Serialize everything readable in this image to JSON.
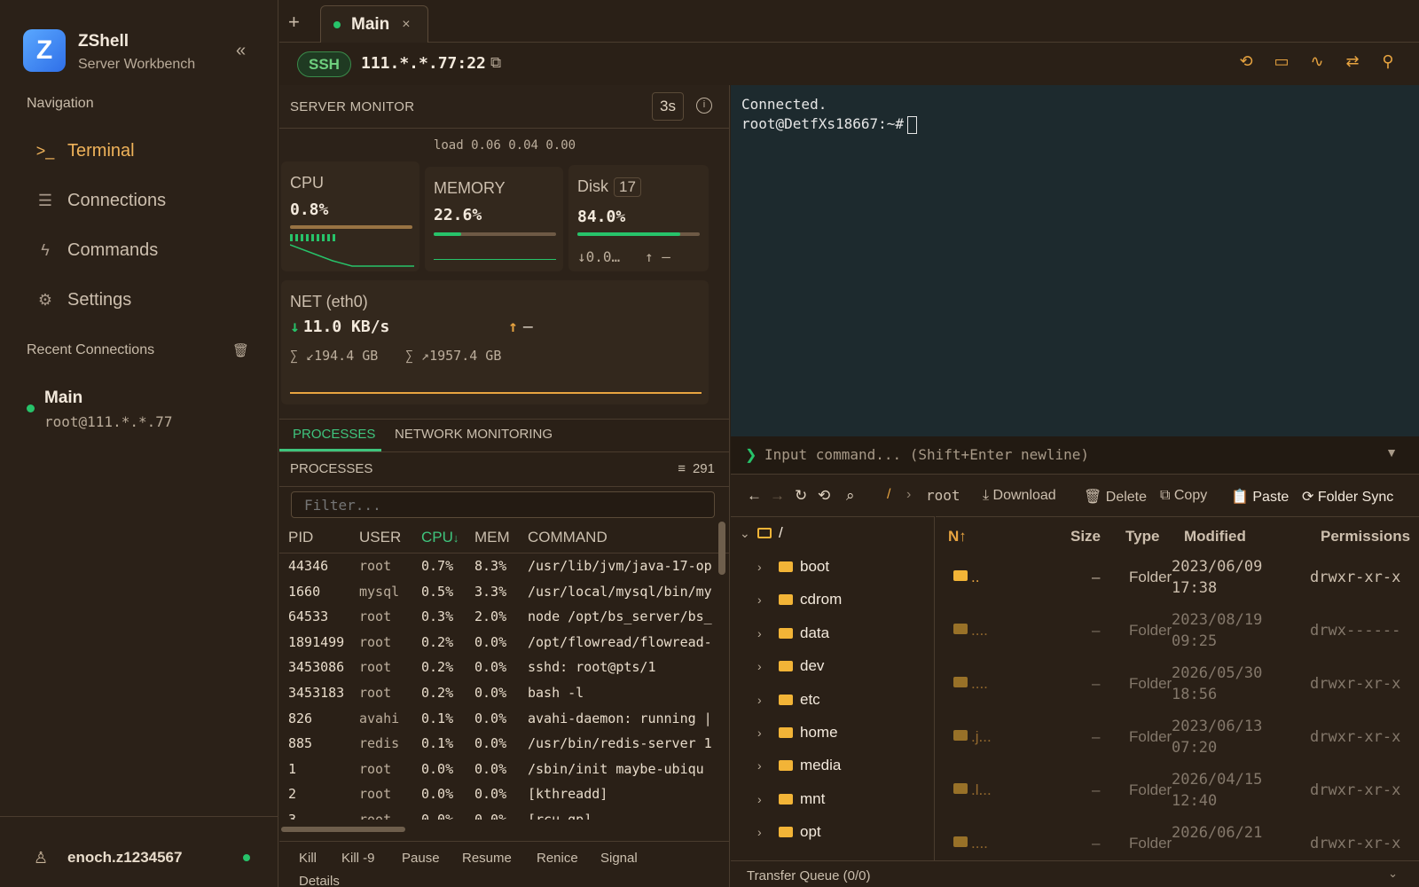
{
  "app": {
    "name": "ZShell",
    "subtitle": "Server Workbench"
  },
  "sidebar": {
    "navigation_title": "Navigation",
    "items": [
      {
        "label": "Terminal",
        "icon": "terminal-icon",
        "active": true
      },
      {
        "label": "Connections",
        "icon": "server-icon",
        "active": false
      },
      {
        "label": "Commands",
        "icon": "bolt-icon",
        "active": false
      },
      {
        "label": "Settings",
        "icon": "gear-icon",
        "active": false
      }
    ],
    "recent_title": "Recent Connections",
    "recent": [
      {
        "name": "Main",
        "address": "root@111.*.*.77",
        "status": "online"
      }
    ],
    "user": {
      "name": "enoch.z1234567",
      "status": "online"
    }
  },
  "tabs": [
    {
      "label": "Main",
      "close": "×",
      "status": "connected"
    }
  ],
  "connection": {
    "protocol": "SSH",
    "host": "111.*.*.77:22"
  },
  "monitor": {
    "title": "SERVER MONITOR",
    "interval": "3s",
    "load": "load 0.06 0.04 0.00",
    "cpu": {
      "label": "CPU",
      "value": "0.8%",
      "fill": 0.008
    },
    "memory": {
      "label": "MEMORY",
      "value": "22.6%",
      "fill": 0.226
    },
    "disk": {
      "label": "Disk",
      "count": "17",
      "value": "84.0%",
      "fill": 0.84,
      "read": "↓0.0…",
      "write": "↑ –"
    },
    "net": {
      "label": "NET (eth0)",
      "down": "11.0 KB/s",
      "up": "–",
      "total_down": "∑ ↙194.4 GB",
      "total_up": "∑ ↗1957.4 GB"
    }
  },
  "process_tabs": {
    "processes": "PROCESSES",
    "network": "NETWORK MONITORING"
  },
  "processes": {
    "title": "PROCESSES",
    "count": "291",
    "filter_placeholder": "Filter...",
    "columns": {
      "pid": "PID",
      "user": "USER",
      "cpu": "CPU",
      "cpu_sort": "↓",
      "mem": "MEM",
      "command": "COMMAND"
    },
    "rows": [
      {
        "pid": "44346",
        "user": "root",
        "cpu": "0.7%",
        "mem": "8.3%",
        "command": "/usr/lib/jvm/java-17-op"
      },
      {
        "pid": "1660",
        "user": "mysql",
        "cpu": "0.5%",
        "mem": "3.3%",
        "command": "/usr/local/mysql/bin/my"
      },
      {
        "pid": "64533",
        "user": "root",
        "cpu": "0.3%",
        "mem": "2.0%",
        "command": "node /opt/bs_server/bs_"
      },
      {
        "pid": "1891499",
        "user": "root",
        "cpu": "0.2%",
        "mem": "0.0%",
        "command": "/opt/flowread/flowread-"
      },
      {
        "pid": "3453086",
        "user": "root",
        "cpu": "0.2%",
        "mem": "0.0%",
        "command": "sshd: root@pts/1"
      },
      {
        "pid": "3453183",
        "user": "root",
        "cpu": "0.2%",
        "mem": "0.0%",
        "command": "bash -l"
      },
      {
        "pid": "826",
        "user": "avahi",
        "cpu": "0.1%",
        "mem": "0.0%",
        "command": "avahi-daemon: running |"
      },
      {
        "pid": "885",
        "user": "redis",
        "cpu": "0.1%",
        "mem": "0.0%",
        "command": "/usr/bin/redis-server 1"
      },
      {
        "pid": "1",
        "user": "root",
        "cpu": "0.0%",
        "mem": "0.0%",
        "command": "/sbin/init maybe-ubiqu"
      },
      {
        "pid": "2",
        "user": "root",
        "cpu": "0.0%",
        "mem": "0.0%",
        "command": "[kthreadd]"
      },
      {
        "pid": "3",
        "user": "root",
        "cpu": "0.0%",
        "mem": "0.0%",
        "command": "[rcu_gp]"
      }
    ],
    "actions": [
      "Kill",
      "Kill -9",
      "Pause",
      "Resume",
      "Renice",
      "Signal",
      "Details"
    ]
  },
  "terminal": {
    "lines": [
      "Connected.",
      "root@DetfXs18667:~#"
    ],
    "input_placeholder": "Input command... (Shift+Enter newline)"
  },
  "files": {
    "path_root": "/",
    "path_current": "root",
    "actions": {
      "download": "Download",
      "delete": "Delete",
      "copy": "Copy",
      "paste": "Paste",
      "sync": "Folder Sync"
    },
    "tree_root": "/",
    "tree": [
      "boot",
      "cdrom",
      "data",
      "dev",
      "etc",
      "home",
      "media",
      "mnt",
      "opt"
    ],
    "columns": {
      "name": "N",
      "name_sort": "↑",
      "size": "Size",
      "type": "Type",
      "modified": "Modified",
      "permissions": "Permissions"
    },
    "rows": [
      {
        "name": "..",
        "size": "–",
        "type": "Folder",
        "date": "2023/06/09",
        "time": "17:38",
        "perm": "drwxr-xr-x"
      },
      {
        "name": "....",
        "size": "–",
        "type": "Folder",
        "date": "2023/08/19",
        "time": "09:25",
        "perm": "drwx------"
      },
      {
        "name": "....",
        "size": "–",
        "type": "Folder",
        "date": "2026/05/30",
        "time": "18:56",
        "perm": "drwxr-xr-x"
      },
      {
        "name": ".j...",
        "size": "–",
        "type": "Folder",
        "date": "2023/06/13",
        "time": "07:20",
        "perm": "drwxr-xr-x"
      },
      {
        "name": ".l...",
        "size": "–",
        "type": "Folder",
        "date": "2026/04/15",
        "time": "12:40",
        "perm": "drwxr-xr-x"
      },
      {
        "name": "....",
        "size": "–",
        "type": "Folder",
        "date": "2026/06/21",
        "time": "",
        "perm": "drwxr-xr-x"
      }
    ],
    "transfer_queue": "Transfer Queue (0/0)"
  }
}
